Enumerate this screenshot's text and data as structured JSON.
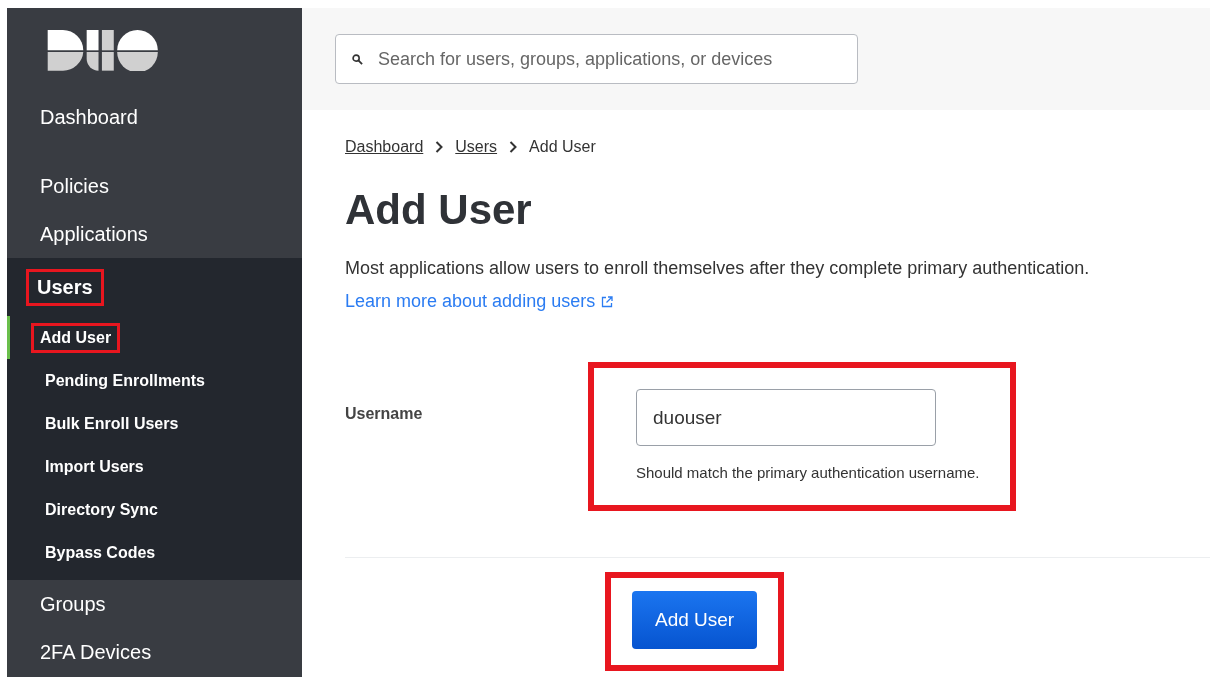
{
  "sidebar": {
    "items": [
      {
        "label": "Dashboard",
        "selected": false,
        "highlighted": false
      },
      {
        "label": "Policies",
        "selected": false,
        "highlighted": false
      },
      {
        "label": "Applications",
        "selected": false,
        "highlighted": false
      },
      {
        "label": "Users",
        "selected": true,
        "highlighted": true,
        "children": [
          {
            "label": "Add User",
            "selected": true,
            "highlighted": true
          },
          {
            "label": "Pending Enrollments",
            "selected": false,
            "highlighted": false
          },
          {
            "label": "Bulk Enroll Users",
            "selected": false,
            "highlighted": false
          },
          {
            "label": "Import Users",
            "selected": false,
            "highlighted": false
          },
          {
            "label": "Directory Sync",
            "selected": false,
            "highlighted": false
          },
          {
            "label": "Bypass Codes",
            "selected": false,
            "highlighted": false
          }
        ]
      },
      {
        "label": "Groups",
        "selected": false,
        "highlighted": false
      },
      {
        "label": "2FA Devices",
        "selected": false,
        "highlighted": false
      }
    ]
  },
  "search": {
    "placeholder": "Search for users, groups, applications, or devices"
  },
  "breadcrumbs": [
    {
      "label": "Dashboard",
      "link": true
    },
    {
      "label": "Users",
      "link": true
    },
    {
      "label": "Add User",
      "link": false
    }
  ],
  "title": "Add User",
  "description": "Most applications allow users to enroll themselves after they complete primary authentication.",
  "learn_more": "Learn more about adding users",
  "form": {
    "label": "Username",
    "value": "duouser",
    "hint": "Should match the primary authentication username.",
    "highlighted": true
  },
  "submit": {
    "label": "Add User",
    "highlighted": true
  }
}
